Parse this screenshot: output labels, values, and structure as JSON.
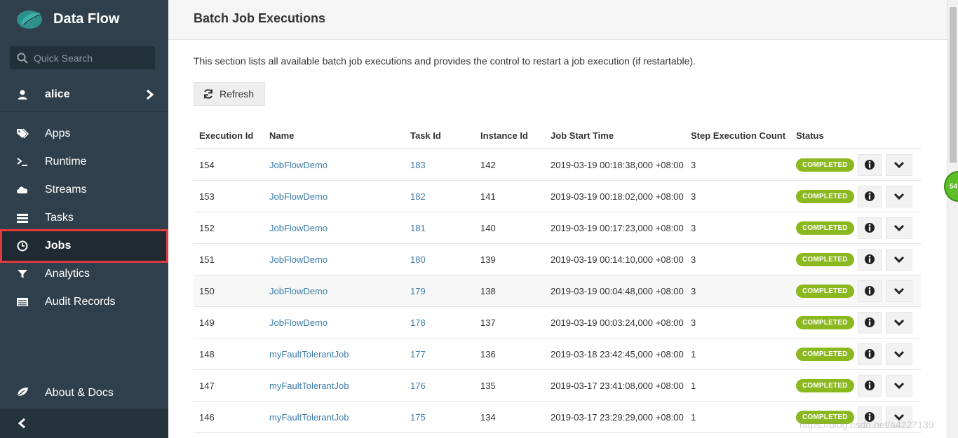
{
  "sidebar": {
    "brand": "Data Flow",
    "search_placeholder": "Quick Search",
    "user": "alice",
    "items": [
      {
        "label": "Apps",
        "icon": "tags-icon"
      },
      {
        "label": "Runtime",
        "icon": "terminal-icon"
      },
      {
        "label": "Streams",
        "icon": "cloud-icon"
      },
      {
        "label": "Tasks",
        "icon": "server-icon"
      },
      {
        "label": "Jobs",
        "icon": "clock-icon",
        "active": true
      },
      {
        "label": "Analytics",
        "icon": "filter-icon"
      },
      {
        "label": "Audit Records",
        "icon": "list-icon"
      }
    ],
    "about": "About & Docs"
  },
  "page": {
    "title": "Batch Job Executions",
    "description": "This section lists all available batch job executions and provides the control to restart a job execution (if restartable).",
    "refresh_label": "Refresh"
  },
  "table": {
    "headers": [
      "Execution Id",
      "Name",
      "Task Id",
      "Instance Id",
      "Job Start Time",
      "Step Execution Count",
      "Status"
    ],
    "rows": [
      {
        "id": "154",
        "name": "JobFlowDemo",
        "task": "183",
        "instance": "142",
        "start": "2019-03-19 00:18:38,000 +08:00",
        "steps": "3",
        "status": "COMPLETED"
      },
      {
        "id": "153",
        "name": "JobFlowDemo",
        "task": "182",
        "instance": "141",
        "start": "2019-03-19 00:18:02,000 +08:00",
        "steps": "3",
        "status": "COMPLETED"
      },
      {
        "id": "152",
        "name": "JobFlowDemo",
        "task": "181",
        "instance": "140",
        "start": "2019-03-19 00:17:23,000 +08:00",
        "steps": "3",
        "status": "COMPLETED"
      },
      {
        "id": "151",
        "name": "JobFlowDemo",
        "task": "180",
        "instance": "139",
        "start": "2019-03-19 00:14:10,000 +08:00",
        "steps": "3",
        "status": "COMPLETED"
      },
      {
        "id": "150",
        "name": "JobFlowDemo",
        "task": "179",
        "instance": "138",
        "start": "2019-03-19 00:04:48,000 +08:00",
        "steps": "3",
        "status": "COMPLETED",
        "highlight": true
      },
      {
        "id": "149",
        "name": "JobFlowDemo",
        "task": "178",
        "instance": "137",
        "start": "2019-03-19 00:03:24,000 +08:00",
        "steps": "3",
        "status": "COMPLETED"
      },
      {
        "id": "148",
        "name": "myFaultTolerantJob",
        "task": "177",
        "instance": "136",
        "start": "2019-03-18 23:42:45,000 +08:00",
        "steps": "1",
        "status": "COMPLETED"
      },
      {
        "id": "147",
        "name": "myFaultTolerantJob",
        "task": "176",
        "instance": "135",
        "start": "2019-03-17 23:41:08,000 +08:00",
        "steps": "1",
        "status": "COMPLETED"
      },
      {
        "id": "146",
        "name": "myFaultTolerantJob",
        "task": "175",
        "instance": "134",
        "start": "2019-03-17 23:29:29,000 +08:00",
        "steps": "1",
        "status": "COMPLETED"
      }
    ]
  },
  "float_badge": "54",
  "watermark": "https://blog.csdn.net/a4227139",
  "colors": {
    "sidebar": "#2f3f4b",
    "accent_link": "#3c7ca8",
    "status_completed": "#8bb81e",
    "active_outline": "#e0393e"
  }
}
